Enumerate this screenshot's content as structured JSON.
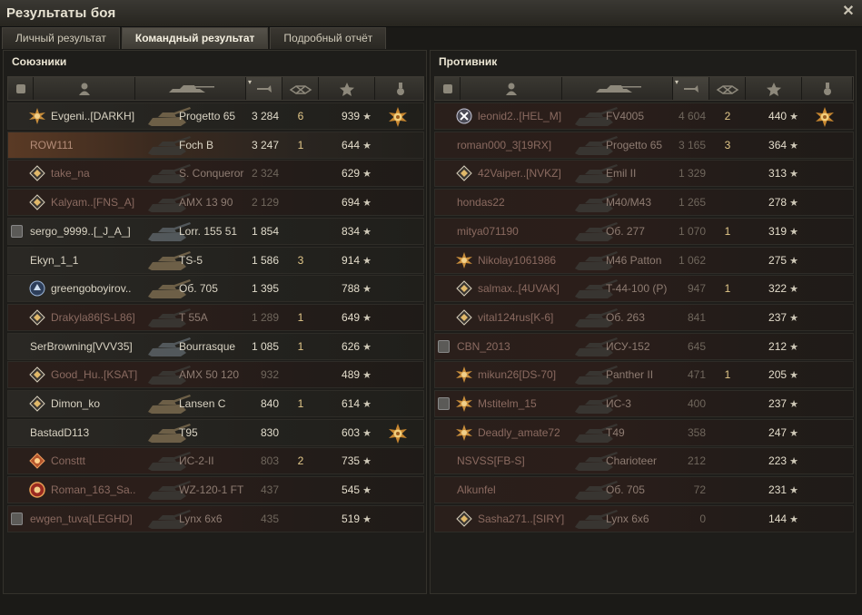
{
  "window": {
    "title": "Результаты боя",
    "close_glyph": "✕"
  },
  "tabs": [
    {
      "label": "Личный результат",
      "active": false
    },
    {
      "label": "Командный результат",
      "active": true
    },
    {
      "label": "Подробный отчёт",
      "active": false
    }
  ],
  "headers": {
    "icons": [
      "platoon-icon",
      "player-icon",
      "tank-icon",
      "damage-icon",
      "kills-icon",
      "xp-star-icon",
      "medal-icon"
    ],
    "sorted": "damage",
    "sort_glyph": "▾"
  },
  "colors": {
    "player_row": "#5a3a25",
    "dead_row": "#2b1e1a",
    "xp_star": "#cfc9b8",
    "kills": "#e3c88a"
  },
  "allies": {
    "title": "Союзники",
    "rows": [
      {
        "name": "Evgeni..[DARKH]",
        "vehicle": "Progetto 65",
        "damage": "3 284",
        "kills": "6",
        "xp": "939",
        "rank": "gold",
        "medal": true,
        "state": "alive",
        "tank_tone": "tan"
      },
      {
        "name": "ROW111",
        "vehicle": "Foch B",
        "damage": "3 247",
        "kills": "1",
        "xp": "644",
        "rank": "",
        "medal": false,
        "state": "player",
        "tank_tone": "dark"
      },
      {
        "name": "take_na",
        "vehicle": "S. Conqueror",
        "damage": "2 324",
        "kills": "",
        "xp": "629",
        "rank": "diamond",
        "medal": false,
        "state": "dead",
        "tank_tone": "dark"
      },
      {
        "name": "Kalyam..[FNS_A]",
        "vehicle": "AMX 13 90",
        "damage": "2 129",
        "kills": "",
        "xp": "694",
        "rank": "diamond",
        "medal": false,
        "state": "dead",
        "tank_tone": "dark"
      },
      {
        "name": "sergo_9999..[_J_A_]",
        "vehicle": "Lorr. 155 51",
        "damage": "1 854",
        "kills": "",
        "xp": "834",
        "rank": "",
        "medal": false,
        "state": "alive",
        "prem": true,
        "tank_tone": "grey"
      },
      {
        "name": "Ekyn_1_1",
        "vehicle": "TS-5",
        "damage": "1 586",
        "kills": "3",
        "xp": "914",
        "rank": "",
        "medal": false,
        "state": "alive",
        "tank_tone": "tan"
      },
      {
        "name": "greengoboyirov..",
        "vehicle": "Об. 705",
        "damage": "1 395",
        "kills": "",
        "xp": "788",
        "rank": "blue",
        "medal": false,
        "state": "alive",
        "tank_tone": "tan"
      },
      {
        "name": "Drakyla86[S-L86]",
        "vehicle": "T 55A",
        "damage": "1 289",
        "kills": "1",
        "xp": "649",
        "rank": "diamond",
        "medal": false,
        "state": "dead",
        "tank_tone": "dark"
      },
      {
        "name": "SerBrowning[VVV35]",
        "vehicle": "Bourrasque",
        "damage": "1 085",
        "kills": "1",
        "xp": "626",
        "rank": "",
        "medal": false,
        "state": "alive",
        "tank_tone": "grey"
      },
      {
        "name": "Good_Hu..[KSAT]",
        "vehicle": "AMX 50 120",
        "damage": "932",
        "kills": "",
        "xp": "489",
        "rank": "diamond",
        "medal": false,
        "state": "dead",
        "tank_tone": "dark"
      },
      {
        "name": "Dimon_ko",
        "vehicle": "Lansen C",
        "damage": "840",
        "kills": "1",
        "xp": "614",
        "rank": "diamond",
        "medal": false,
        "state": "alive",
        "tank_tone": "tan"
      },
      {
        "name": "BastadD113",
        "vehicle": "T95",
        "damage": "830",
        "kills": "",
        "xp": "603",
        "rank": "",
        "medal": true,
        "state": "alive",
        "tank_tone": "tan"
      },
      {
        "name": "Consttt",
        "vehicle": "ИС-2-II",
        "damage": "803",
        "kills": "2",
        "xp": "735",
        "rank": "orange",
        "medal": false,
        "state": "dead",
        "tank_tone": "dark"
      },
      {
        "name": "Roman_163_Sa..",
        "vehicle": "WZ-120-1 FT",
        "damage": "437",
        "kills": "",
        "xp": "545",
        "rank": "red",
        "medal": false,
        "state": "dead",
        "tank_tone": "dark"
      },
      {
        "name": "ewgen_tuva[LEGHD]",
        "vehicle": "Lynx 6x6",
        "damage": "435",
        "kills": "",
        "xp": "519",
        "rank": "",
        "medal": false,
        "state": "dead",
        "prem": true,
        "tank_tone": "dark"
      }
    ]
  },
  "enemies": {
    "title": "Противник",
    "rows": [
      {
        "name": "leonid2..[HEL_M]",
        "vehicle": "FV4005",
        "damage": "4 604",
        "kills": "2",
        "xp": "440",
        "rank": "x",
        "medal": true,
        "state": "dead",
        "tank_tone": "dark"
      },
      {
        "name": "roman000_3[19RX]",
        "vehicle": "Progetto 65",
        "damage": "3 165",
        "kills": "3",
        "xp": "364",
        "rank": "",
        "medal": false,
        "state": "dead",
        "tank_tone": "dark"
      },
      {
        "name": "42Vaiper..[NVKZ]",
        "vehicle": "Emil II",
        "damage": "1 329",
        "kills": "",
        "xp": "313",
        "rank": "diamond",
        "medal": false,
        "state": "dead",
        "tank_tone": "dark"
      },
      {
        "name": "hondas22",
        "vehicle": "M40/M43",
        "damage": "1 265",
        "kills": "",
        "xp": "278",
        "rank": "",
        "medal": false,
        "state": "dead",
        "tank_tone": "dark"
      },
      {
        "name": "mitya071190",
        "vehicle": "Об. 277",
        "damage": "1 070",
        "kills": "1",
        "xp": "319",
        "rank": "",
        "medal": false,
        "state": "dead",
        "tank_tone": "dark"
      },
      {
        "name": "Nikolay1061986",
        "vehicle": "M46 Patton",
        "damage": "1 062",
        "kills": "",
        "xp": "275",
        "rank": "gold",
        "medal": false,
        "state": "dead",
        "tank_tone": "dark"
      },
      {
        "name": "salmax..[4UVAK]",
        "vehicle": "T-44-100 (P)",
        "damage": "947",
        "kills": "1",
        "xp": "322",
        "rank": "diamond",
        "medal": false,
        "state": "dead",
        "tank_tone": "dark"
      },
      {
        "name": "vital124rus[K-6]",
        "vehicle": "Об. 263",
        "damage": "841",
        "kills": "",
        "xp": "237",
        "rank": "diamond",
        "medal": false,
        "state": "dead",
        "tank_tone": "dark"
      },
      {
        "name": "CBN_2013",
        "vehicle": "ИСУ-152",
        "damage": "645",
        "kills": "",
        "xp": "212",
        "rank": "",
        "medal": false,
        "state": "dead",
        "prem": true,
        "tank_tone": "dark"
      },
      {
        "name": "mikun26[DS-70]",
        "vehicle": "Panther II",
        "damage": "471",
        "kills": "1",
        "xp": "205",
        "rank": "gold",
        "medal": false,
        "state": "dead",
        "tank_tone": "dark"
      },
      {
        "name": "Mstitelm_15",
        "vehicle": "ИС-3",
        "damage": "400",
        "kills": "",
        "xp": "237",
        "rank": "gold",
        "medal": false,
        "state": "dead",
        "prem": true,
        "tank_tone": "dark"
      },
      {
        "name": "Deadly_amate72",
        "vehicle": "T49",
        "damage": "358",
        "kills": "",
        "xp": "247",
        "rank": "gold",
        "medal": false,
        "state": "dead",
        "tank_tone": "dark"
      },
      {
        "name": "NSVSS[FB-S]",
        "vehicle": "Charioteer",
        "damage": "212",
        "kills": "",
        "xp": "223",
        "rank": "",
        "medal": false,
        "state": "dead",
        "tank_tone": "dark"
      },
      {
        "name": "Alkunfel",
        "vehicle": "Об. 705",
        "damage": "72",
        "kills": "",
        "xp": "231",
        "rank": "",
        "medal": false,
        "state": "dead",
        "tank_tone": "dark"
      },
      {
        "name": "Sasha271..[SIRY]",
        "vehicle": "Lynx 6x6",
        "damage": "0",
        "kills": "",
        "xp": "144",
        "rank": "diamond",
        "medal": false,
        "state": "dead",
        "tank_tone": "dark"
      }
    ]
  }
}
